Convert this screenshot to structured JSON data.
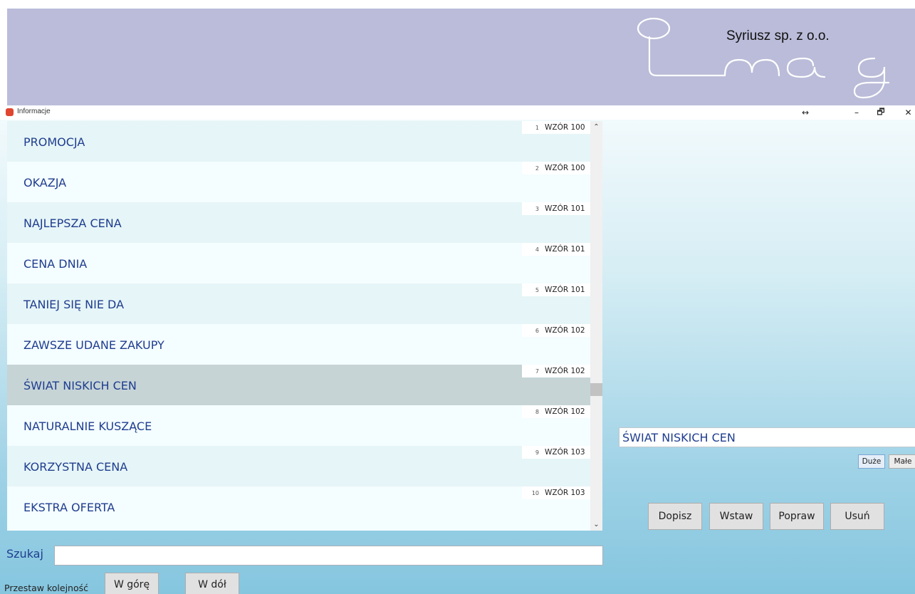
{
  "banner": {
    "company": "Syriusz sp. z o.o.",
    "logo_icon": "imag-logo"
  },
  "window": {
    "title": "Informacje",
    "app_icon": "app-icon",
    "controls": {
      "resize": "↔",
      "minimize": "–",
      "maximize": "🗗",
      "close": "✕"
    }
  },
  "list": {
    "items": [
      {
        "num": "1",
        "pattern": "WZÓR 100",
        "label": "PROMOCJA"
      },
      {
        "num": "2",
        "pattern": "WZÓR 100",
        "label": "OKAZJA"
      },
      {
        "num": "3",
        "pattern": "WZÓR 101",
        "label": "NAJLEPSZA CENA"
      },
      {
        "num": "4",
        "pattern": "WZÓR 101",
        "label": "CENA DNIA"
      },
      {
        "num": "5",
        "pattern": "WZÓR 101",
        "label": "TANIEJ SIĘ NIE DA"
      },
      {
        "num": "6",
        "pattern": "WZÓR 102",
        "label": "ZAWSZE UDANE ZAKUPY"
      },
      {
        "num": "7",
        "pattern": "WZÓR 102",
        "label": "ŚWIAT NISKICH CEN"
      },
      {
        "num": "8",
        "pattern": "WZÓR 102",
        "label": "NATURALNIE KUSZĄCE"
      },
      {
        "num": "9",
        "pattern": "WZÓR 103",
        "label": "KORZYSTNA CENA"
      },
      {
        "num": "10",
        "pattern": "WZÓR 103",
        "label": "EKSTRA OFERTA"
      }
    ],
    "selected_index": 6,
    "scroll_up": "⌃",
    "scroll_down": "⌄"
  },
  "editor": {
    "value": "ŚWIAT NISKICH CEN",
    "case_large": "Duże",
    "case_small": "Małe",
    "buttons": {
      "append": "Dopisz",
      "insert": "Wstaw",
      "edit": "Popraw",
      "delete": "Usuń"
    }
  },
  "search": {
    "label": "Szukaj",
    "value": ""
  },
  "reorder": {
    "label": "Przestaw kolejność",
    "up": "W górę",
    "down": "W dół"
  },
  "colors": {
    "banner": "#babcd9",
    "list_text": "#1f3d8f",
    "selected_row": "#c6d4d6"
  }
}
